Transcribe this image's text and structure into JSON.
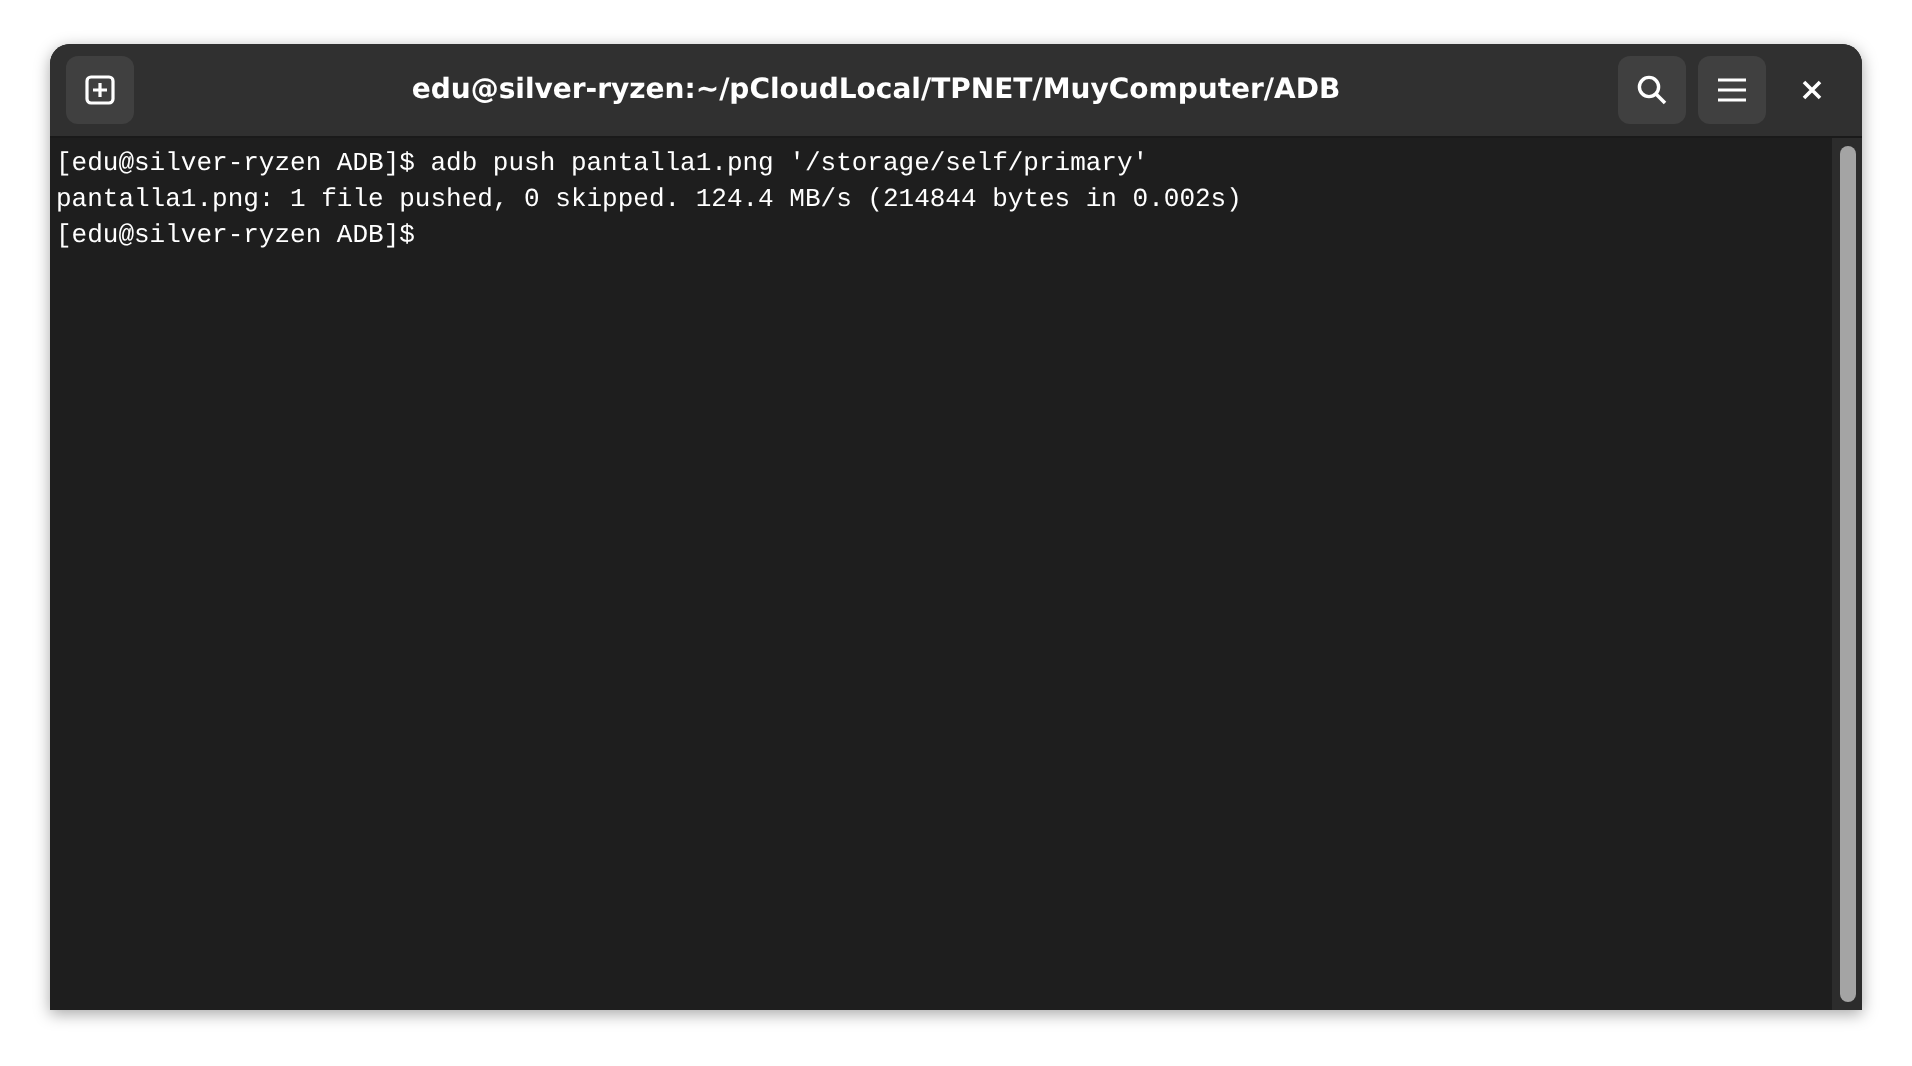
{
  "window": {
    "title": "edu@silver-ryzen:~/pCloudLocal/TPNET/MuyComputer/ADB"
  },
  "terminal": {
    "lines": [
      "[edu@silver-ryzen ADB]$ adb push pantalla1.png '/storage/self/primary'",
      "pantalla1.png: 1 file pushed, 0 skipped. 124.4 MB/s (214844 bytes in 0.002s)",
      "[edu@silver-ryzen ADB]$"
    ]
  }
}
